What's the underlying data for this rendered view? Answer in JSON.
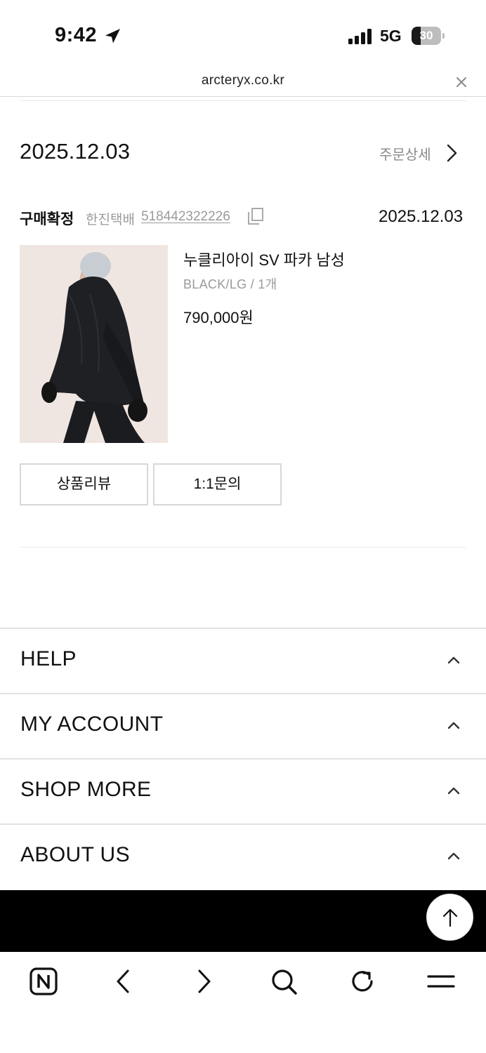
{
  "status_bar": {
    "time": "9:42",
    "network": "5G",
    "battery_level": "30"
  },
  "browser": {
    "url": "arcteryx.co.kr"
  },
  "order": {
    "date": "2025.12.03",
    "detail_link": "주문상세",
    "status": "구매확정",
    "carrier": "한진택배",
    "tracking_number": "518442322226",
    "status_date": "2025.12.03",
    "product": {
      "name": "누클리아이 SV 파카 남성",
      "option": "BLACK/LG / 1개",
      "price": "790,000원"
    },
    "buttons": {
      "review": "상품리뷰",
      "inquiry": "1:1문의"
    }
  },
  "footer": {
    "sections": [
      "HELP",
      "MY ACCOUNT",
      "SHOP MORE",
      "ABOUT US"
    ]
  },
  "icons": {
    "location": "location-arrow-icon",
    "close": "close-icon",
    "chevron_right": "chevron-right-icon",
    "copy": "copy-icon",
    "chevron_up": "chevron-up-icon",
    "scroll_top": "arrow-up-icon",
    "naver": "naver-n-icon",
    "back": "back-icon",
    "forward": "forward-icon",
    "search": "search-icon",
    "reload": "reload-icon",
    "menu": "menu-icon"
  },
  "colors": {
    "muted_text": "#9a9a9a",
    "divider": "#e3e3e3",
    "footer_band": "#000000"
  }
}
